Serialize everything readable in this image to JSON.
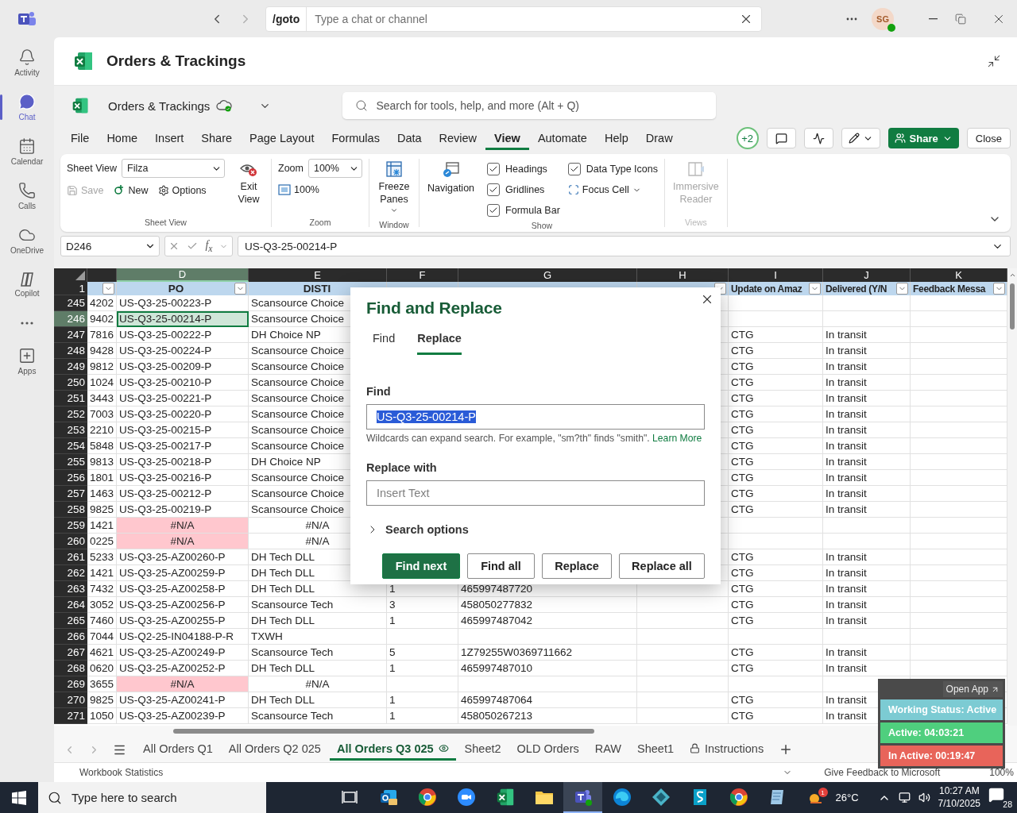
{
  "titlebar": {
    "goto": "/goto",
    "search_placeholder": "Type a chat or channel",
    "avatar": "SG"
  },
  "rail": [
    {
      "label": "Activity",
      "selected": false
    },
    {
      "label": "Chat",
      "selected": true
    },
    {
      "label": "Calendar",
      "selected": false
    },
    {
      "label": "Calls",
      "selected": false
    },
    {
      "label": "OneDrive",
      "selected": false
    },
    {
      "label": "Copilot",
      "selected": false
    },
    {
      "selected": false
    },
    {
      "label": "Apps",
      "selected": false
    }
  ],
  "app_header": {
    "title": "Orders & Trackings"
  },
  "excel": {
    "doc_title": "Orders & Trackings",
    "search_placeholder": "Search for tools, help, and more (Alt + Q)"
  },
  "menu": [
    {
      "label": "File",
      "selected": false
    },
    {
      "label": "Home",
      "selected": false
    },
    {
      "label": "Insert",
      "selected": false
    },
    {
      "label": "Share",
      "selected": false
    },
    {
      "label": "Page Layout",
      "selected": false
    },
    {
      "label": "Formulas",
      "selected": false
    },
    {
      "label": "Data",
      "selected": false
    },
    {
      "label": "Review",
      "selected": false
    },
    {
      "label": "View",
      "selected": true
    },
    {
      "label": "Automate",
      "selected": false
    },
    {
      "label": "Help",
      "selected": false
    },
    {
      "label": "Draw",
      "selected": false
    }
  ],
  "toolbar_right": {
    "coauthors": "+2",
    "share": "Share",
    "close": "Close"
  },
  "ribbon": {
    "sheet_view": {
      "label": "Sheet View",
      "value": "Filza",
      "actions": [
        {
          "label": "Save",
          "disabled": true
        },
        {
          "label": "New",
          "disabled": false
        },
        {
          "label": "Options",
          "disabled": false
        }
      ],
      "exit": "Exit View",
      "group": "Sheet View"
    },
    "zoom": {
      "label": "Zoom",
      "value": "100%",
      "reset": "100%",
      "group": "Zoom"
    },
    "window": {
      "freeze": "Freeze Panes",
      "group": "Window"
    },
    "show": {
      "navigation": "Navigation",
      "checks": [
        {
          "label": "Headings",
          "checked": true
        },
        {
          "label": "Gridlines",
          "checked": true
        },
        {
          "label": "Formula Bar",
          "checked": true
        },
        {
          "label": "Data Type Icons",
          "checked": true
        }
      ],
      "focus_cell": "Focus Cell",
      "group": "Show"
    },
    "views": {
      "immersive": "Immersive Reader",
      "disabled": true,
      "group": "Views"
    }
  },
  "formula_bar": {
    "name_box": "D246",
    "fx": "f$_{x}$",
    "value": "US-Q3-25-00214-P"
  },
  "grid": {
    "columns": [
      {
        "filter": true,
        "selected": false
      },
      {
        "letter": "D",
        "header": "PO",
        "filter": true,
        "selected": true
      },
      {
        "letter": "E",
        "header": "DISTI",
        "filter": false,
        "selected": false
      },
      {
        "letter": "F",
        "filter": false,
        "selected": false
      },
      {
        "letter": "G",
        "filter": false,
        "selected": false
      },
      {
        "letter": "H",
        "filter": true,
        "selected": false
      },
      {
        "letter": "I",
        "header": "Update on Amaz",
        "filter": true,
        "selected": false
      },
      {
        "letter": "J",
        "header": "Delivered (Y/N",
        "filter": true,
        "selected": false
      },
      {
        "letter": "K",
        "header": "Feedback Messa",
        "filter": true,
        "selected": false
      }
    ],
    "header_row": "1",
    "rows": [
      {
        "num": "245",
        "selected": false,
        "error": false,
        "cells": [
          "4202",
          "US-Q3-25-00223-P",
          "Scansource Choice",
          null,
          null,
          null,
          null,
          null,
          null
        ]
      },
      {
        "num": "246",
        "selected": true,
        "error": false,
        "cells": [
          "9402",
          "US-Q3-25-00214-P",
          "Scansource Choice",
          null,
          null,
          null,
          null,
          null,
          null
        ]
      },
      {
        "num": "247",
        "selected": false,
        "error": false,
        "cells": [
          "7816",
          "US-Q3-25-00222-P",
          "DH Choice NP",
          null,
          null,
          null,
          "CTG",
          "In transit",
          null
        ]
      },
      {
        "num": "248",
        "selected": false,
        "error": false,
        "cells": [
          "9428",
          "US-Q3-25-00224-P",
          "Scansource Choice",
          null,
          null,
          null,
          "CTG",
          "In transit",
          null
        ]
      },
      {
        "num": "249",
        "selected": false,
        "error": false,
        "cells": [
          "9812",
          "US-Q3-25-00209-P",
          "Scansource Choice",
          null,
          null,
          null,
          "CTG",
          "In transit",
          null
        ]
      },
      {
        "num": "250",
        "selected": false,
        "error": false,
        "cells": [
          "1024",
          "US-Q3-25-00210-P",
          "Scansource Choice",
          null,
          null,
          null,
          "CTG",
          "In transit",
          null
        ]
      },
      {
        "num": "251",
        "selected": false,
        "error": false,
        "cells": [
          "3443",
          "US-Q3-25-00221-P",
          "Scansource Choice",
          null,
          null,
          null,
          "CTG",
          "In transit",
          null
        ]
      },
      {
        "num": "252",
        "selected": false,
        "error": false,
        "cells": [
          "7003",
          "US-Q3-25-00220-P",
          "Scansource Choice",
          null,
          null,
          null,
          "CTG",
          "In transit",
          null
        ]
      },
      {
        "num": "253",
        "selected": false,
        "error": false,
        "cells": [
          "2210",
          "US-Q3-25-00215-P",
          "Scansource Choice",
          null,
          null,
          null,
          "CTG",
          "In transit",
          null
        ]
      },
      {
        "num": "254",
        "selected": false,
        "error": false,
        "cells": [
          "5848",
          "US-Q3-25-00217-P",
          "Scansource Choice",
          null,
          null,
          null,
          "CTG",
          "In transit",
          null
        ]
      },
      {
        "num": "255",
        "selected": false,
        "error": false,
        "cells": [
          "9813",
          "US-Q3-25-00218-P",
          "DH Choice NP",
          null,
          null,
          null,
          "CTG",
          "In transit",
          null
        ]
      },
      {
        "num": "256",
        "selected": false,
        "error": false,
        "cells": [
          "1801",
          "US-Q3-25-00216-P",
          "Scansource Choice",
          null,
          null,
          null,
          "CTG",
          "In transit",
          null
        ]
      },
      {
        "num": "257",
        "selected": false,
        "error": false,
        "cells": [
          "1463",
          "US-Q3-25-00212-P",
          "Scansource Choice",
          null,
          null,
          null,
          "CTG",
          "In transit",
          null
        ]
      },
      {
        "num": "258",
        "selected": false,
        "error": false,
        "cells": [
          "9825",
          "US-Q3-25-00219-P",
          "Scansource Choice",
          null,
          null,
          null,
          "CTG",
          "In transit",
          null
        ]
      },
      {
        "num": "259",
        "selected": false,
        "error": true,
        "cells": [
          "1421",
          "#N/A",
          "#N/A",
          null,
          null,
          null,
          null,
          null,
          null
        ]
      },
      {
        "num": "260",
        "selected": false,
        "error": true,
        "cells": [
          "0225",
          "#N/A",
          "#N/A",
          null,
          null,
          null,
          null,
          null,
          null
        ]
      },
      {
        "num": "261",
        "selected": false,
        "error": false,
        "cells": [
          "5233",
          "US-Q3-25-AZ00260-P",
          "DH Tech DLL",
          null,
          null,
          null,
          "CTG",
          "In transit",
          null
        ]
      },
      {
        "num": "262",
        "selected": false,
        "error": false,
        "cells": [
          "1421",
          "US-Q3-25-AZ00259-P",
          "DH Tech DLL",
          null,
          null,
          null,
          "CTG",
          "In transit",
          null
        ]
      },
      {
        "num": "263",
        "selected": false,
        "error": false,
        "cells": [
          "7432",
          "US-Q3-25-AZ00258-P",
          "DH Tech DLL",
          "1",
          "465997487720",
          null,
          "CTG",
          "In transit",
          null
        ]
      },
      {
        "num": "264",
        "selected": false,
        "error": false,
        "cells": [
          "3052",
          "US-Q3-25-AZ00256-P",
          "Scansource Tech",
          "3",
          "458050277832",
          null,
          "CTG",
          "In transit",
          null
        ]
      },
      {
        "num": "265",
        "selected": false,
        "error": false,
        "cells": [
          "7460",
          "US-Q3-25-AZ00255-P",
          "DH Tech DLL",
          "1",
          "465997487042",
          null,
          "CTG",
          "In transit",
          null
        ]
      },
      {
        "num": "266",
        "selected": false,
        "error": false,
        "cells": [
          "7044",
          "US-Q2-25-IN04188-P-R",
          "TXWH",
          null,
          null,
          null,
          null,
          null,
          null
        ]
      },
      {
        "num": "267",
        "selected": false,
        "error": false,
        "cells": [
          "4621",
          "US-Q3-25-AZ00249-P",
          "Scansource Tech",
          "5",
          "1Z79255W0369711662",
          null,
          "CTG",
          "In transit",
          null
        ]
      },
      {
        "num": "268",
        "selected": false,
        "error": false,
        "cells": [
          "0620",
          "US-Q3-25-AZ00252-P",
          "DH Tech DLL",
          "1",
          "465997487010",
          null,
          "CTG",
          "In transit",
          null
        ]
      },
      {
        "num": "269",
        "selected": false,
        "error": true,
        "cells": [
          "3655",
          "#N/A",
          "#N/A",
          null,
          null,
          null,
          null,
          null,
          null
        ]
      },
      {
        "num": "270",
        "selected": false,
        "error": false,
        "cells": [
          "9825",
          "US-Q3-25-AZ00241-P",
          "DH Tech DLL",
          "1",
          "465997487064",
          null,
          "CTG",
          "In transit",
          null
        ]
      },
      {
        "num": "271",
        "selected": false,
        "error": false,
        "cells": [
          "1050",
          "US-Q3-25-AZ00239-P",
          "Scansource Tech",
          "1",
          "458050267213",
          null,
          "CTG",
          "In transit",
          null
        ]
      }
    ]
  },
  "dialog": {
    "title": "Find and Replace",
    "tabs": [
      {
        "label": "Find",
        "selected": false
      },
      {
        "label": "Replace",
        "selected": true
      }
    ],
    "find_label": "Find",
    "find_value": "US-Q3-25-00214-P",
    "find_text_selected": true,
    "hint": "Wildcards can expand search. For example, \"sm?th\" finds \"smith\".",
    "learn_more": "Learn More",
    "replace_label": "Replace with",
    "replace_placeholder": "Insert Text",
    "search_options": "Search options",
    "buttons": [
      {
        "label": "Find next",
        "primary": true
      },
      {
        "label": "Find all",
        "primary": false
      },
      {
        "label": "Replace",
        "primary": false
      },
      {
        "label": "Replace all",
        "primary": false
      }
    ]
  },
  "sheet_tabs": [
    {
      "label": "All Orders Q1",
      "selected": false,
      "kind": "plain"
    },
    {
      "label": "All Orders Q2 025",
      "selected": false,
      "kind": "plain"
    },
    {
      "label": "All Orders Q3 025",
      "selected": true,
      "kind": "watched"
    },
    {
      "label": "Sheet2",
      "selected": false,
      "kind": "plain"
    },
    {
      "label": "OLD Orders",
      "selected": false,
      "kind": "plain"
    },
    {
      "label": "RAW",
      "selected": false,
      "kind": "plain"
    },
    {
      "label": "Sheet1",
      "selected": false,
      "kind": "plain"
    },
    {
      "label": "Instructions",
      "selected": false,
      "kind": "locked"
    }
  ],
  "status_bar": {
    "left": "Workbook Statistics",
    "feedback": "Give Feedback to Microsoft",
    "zoom": "100%"
  },
  "widget": {
    "open_app": "Open App",
    "items": [
      {
        "label": "Working Status: Active",
        "color": "#7ccbd3"
      },
      {
        "label": "Active: 04:03:21",
        "color": "#4fcf7e"
      },
      {
        "label": "In Active: 00:19:47",
        "color": "#e8645a"
      }
    ]
  },
  "taskbar": {
    "search_placeholder": "Type here to search",
    "apps": [
      {
        "selected": false
      },
      {
        "selected": false
      },
      {
        "selected": false
      },
      {
        "selected": false
      },
      {
        "selected": false
      },
      {
        "selected": false
      },
      {
        "selected": true
      },
      {
        "selected": false
      },
      {
        "selected": false
      },
      {
        "selected": false
      },
      {
        "selected": false
      },
      {
        "selected": false
      }
    ],
    "weather": "26°C",
    "weather_badge": "1",
    "time": "10:27 AM",
    "date": "7/10/2025",
    "notifications": "28"
  }
}
